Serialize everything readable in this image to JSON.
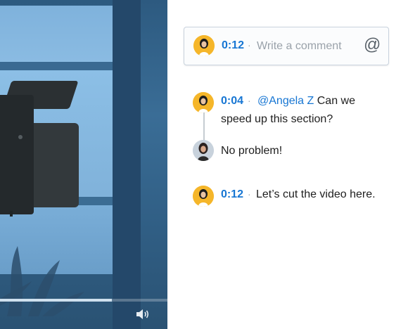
{
  "video": {
    "progress_fraction": 0.67,
    "volume_icon": "speaker-icon"
  },
  "composer": {
    "timestamp": "0:12",
    "separator": "·",
    "placeholder": "Write a comment",
    "mention_icon_glyph": "@"
  },
  "comments": [
    {
      "timestamp": "0:04",
      "separator": "·",
      "mention": "@Angela Z",
      "text_line1": "Can we",
      "text_line2": "speed up this section?"
    },
    {
      "reply": true,
      "text": "No problem!"
    },
    {
      "timestamp": "0:12",
      "separator": "·",
      "text": "Let’s cut the video here."
    }
  ],
  "colors": {
    "accent": "#1776d3",
    "avatar_bg": "#f5b62a"
  }
}
